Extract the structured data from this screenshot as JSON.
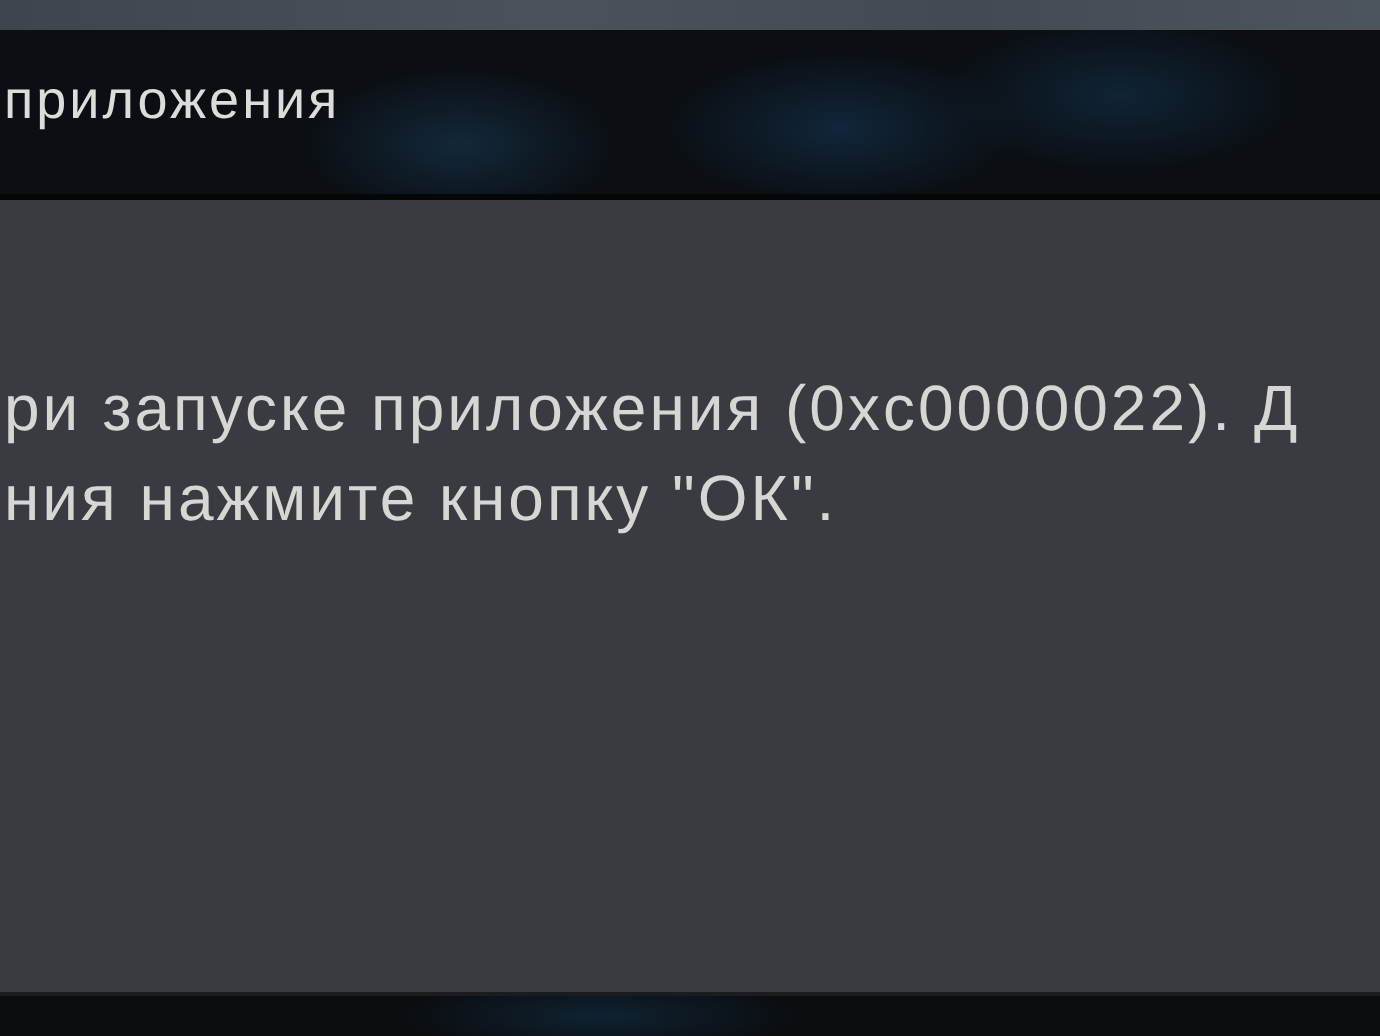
{
  "dialog": {
    "title": "приложения",
    "message_lines": [
      "ри запуске приложения (0xc0000022). Д",
      "ния нажмите кнопку \"ОК\"."
    ]
  }
}
